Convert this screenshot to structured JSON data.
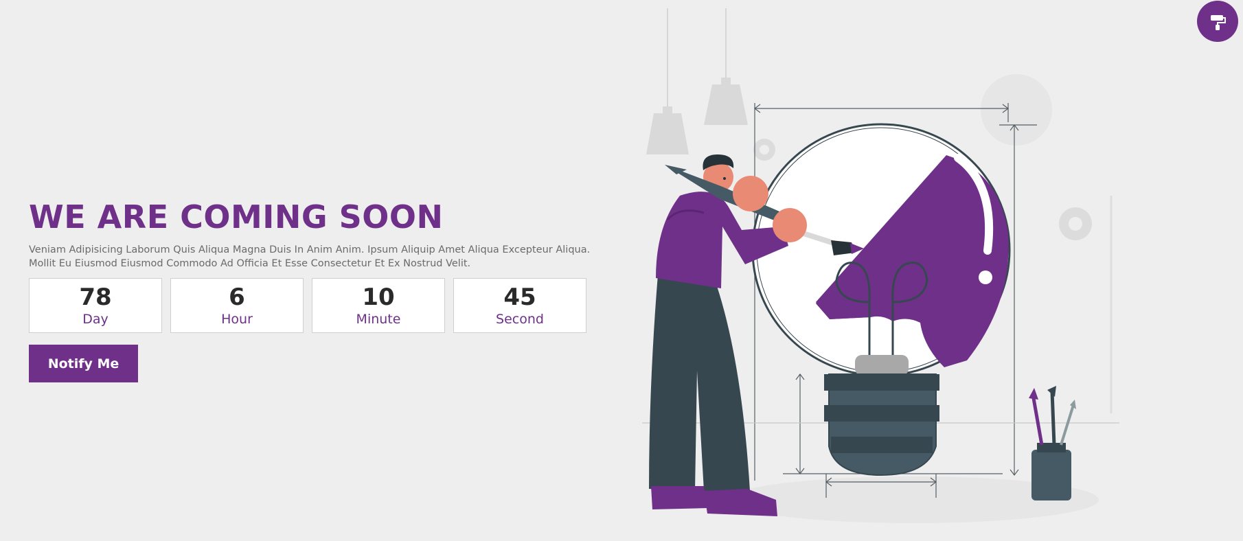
{
  "hero": {
    "title": "WE ARE COMING SOON",
    "description": "Veniam Adipisicing Laborum Quis Aliqua Magna Duis In Anim Anim. Ipsum Aliquip Amet Aliqua Excepteur Aliqua. Mollit Eu Eiusmod Eiusmod Commodo Ad Officia Et Esse Consectetur Et Ex Nostrud Velit."
  },
  "countdown": [
    {
      "value": "78",
      "label": "Day"
    },
    {
      "value": "6",
      "label": "Hour"
    },
    {
      "value": "10",
      "label": "Minute"
    },
    {
      "value": "45",
      "label": "Second"
    }
  ],
  "cta": {
    "label": "Notify Me"
  },
  "floating_button": {
    "icon": "paint-roller-icon"
  },
  "illustration": {
    "icon": "painter-lightbulb-illustration"
  },
  "colors": {
    "accent": "#6f3089",
    "background": "#eeeeee",
    "dark": "#37474f"
  }
}
